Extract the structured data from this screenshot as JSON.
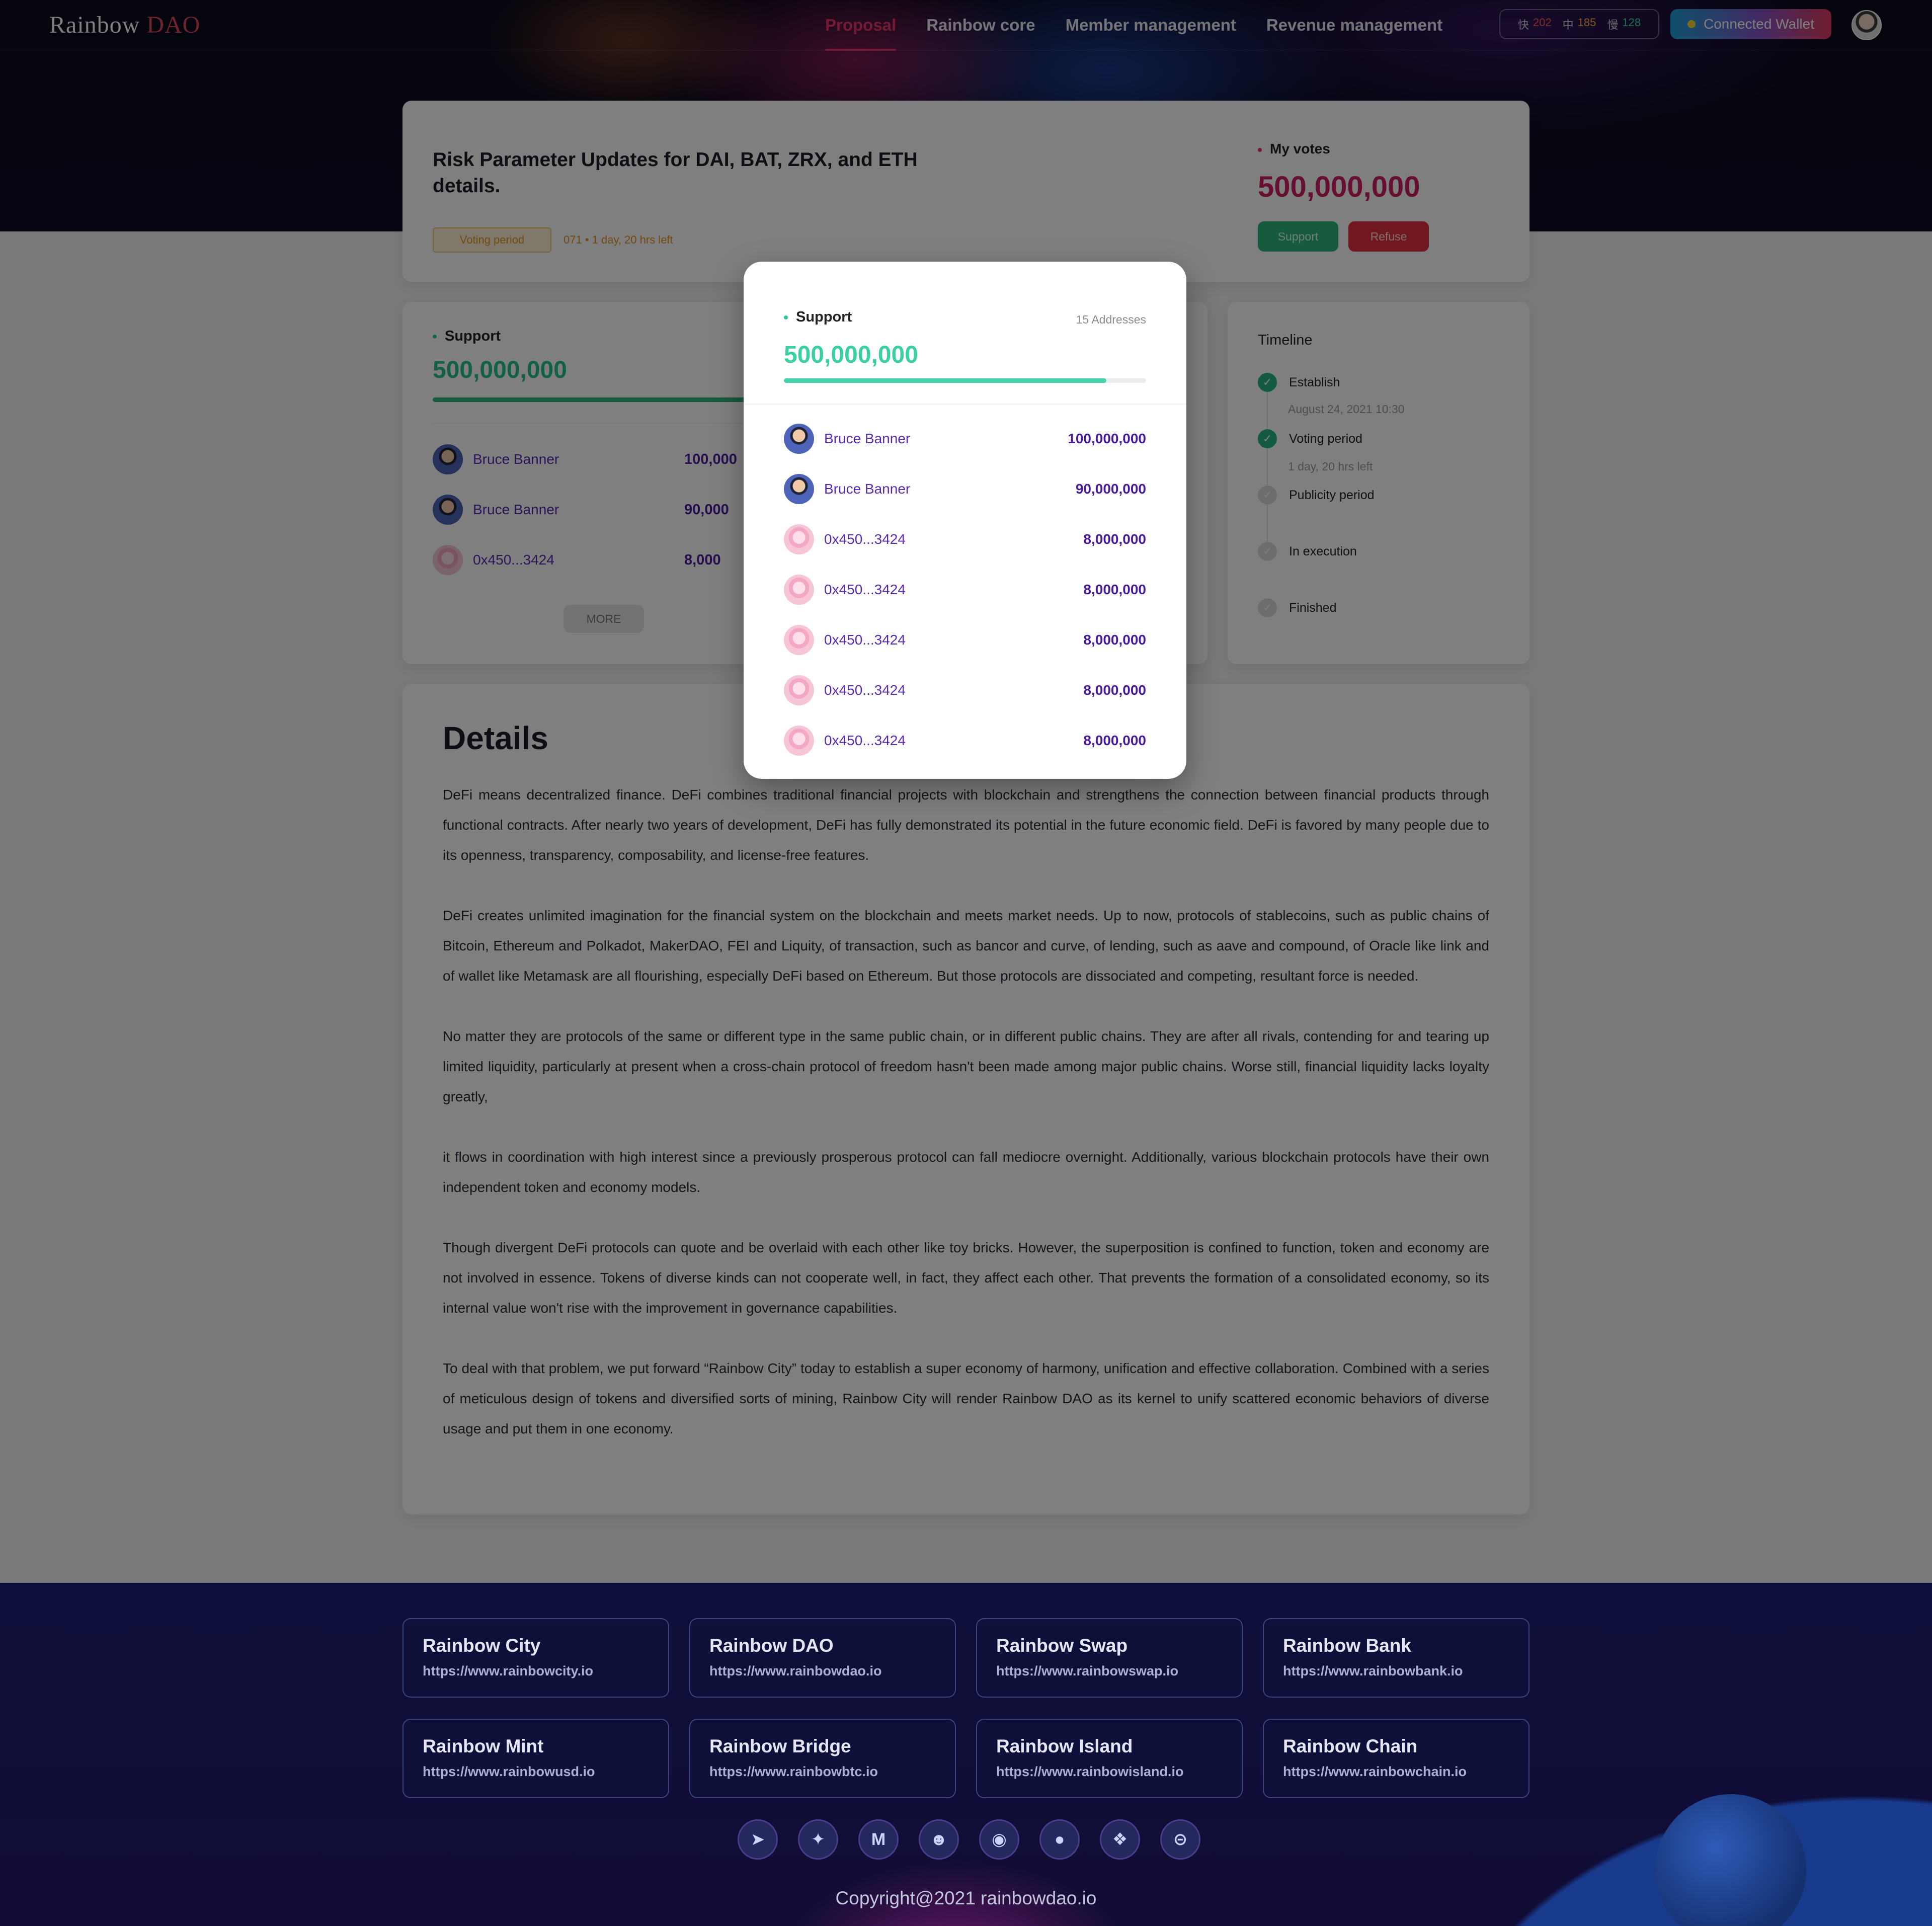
{
  "nav": {
    "logo_text": "Rainbow",
    "logo_accent": "DAO",
    "links": [
      "Proposal",
      "Rainbow core",
      "Member management",
      "Revenue management"
    ],
    "active_link": "Proposal",
    "stats": [
      {
        "key": "快",
        "value": "202",
        "color": "#ff5a5a"
      },
      {
        "key": "中",
        "value": "185",
        "color": "#ffb341"
      },
      {
        "key": "慢",
        "value": "128",
        "color": "#3ee0a4"
      }
    ],
    "wallet_label": "Connected Wallet"
  },
  "proposal": {
    "title": "Risk Parameter Updates for DAI, BAT, ZRX, and ETH details.",
    "status_badge": "Voting period",
    "time_left": "071 • 1 day, 20 hrs left",
    "my_votes_label": "My votes",
    "my_votes_value": "500,000,000",
    "support_button": "Support",
    "refuse_button": "Refuse"
  },
  "support_panel": {
    "label": "Support",
    "value": "500,000,000",
    "progress_fraction": 0.9,
    "rows": [
      {
        "name": "Bruce Banner",
        "amount": "100,000",
        "avatar": "person"
      },
      {
        "name": "Bruce Banner",
        "amount": "90,000",
        "avatar": "person"
      },
      {
        "name": "0x450...3424",
        "amount": "8,000",
        "avatar": "pig"
      }
    ],
    "more_button": "MORE"
  },
  "timeline": {
    "title": "Timeline",
    "steps": [
      {
        "name": "Establish",
        "sub": "August 24, 2021  10:30",
        "done": true
      },
      {
        "name": "Voting period",
        "sub": "1 day, 20 hrs left",
        "done": true
      },
      {
        "name": "Publicity period",
        "sub": "",
        "done": false
      },
      {
        "name": "In execution",
        "sub": "",
        "done": false
      },
      {
        "name": "Finished",
        "sub": "",
        "done": false
      }
    ]
  },
  "details": {
    "title": "Details",
    "paragraphs": [
      "DeFi means decentralized finance. DeFi combines traditional financial projects with blockchain and strengthens the connection between financial products through functional contracts. After nearly two years of development, DeFi has fully demonstrated its potential in the future economic field. DeFi is favored by many people due to its openness, transparency, composability, and license-free features.",
      "DeFi creates unlimited imagination for the financial system on the blockchain and meets market needs. Up to now, protocols of stablecoins, such as public chains of Bitcoin, Ethereum and Polkadot, MakerDAO, FEI and Liquity, of transaction, such as bancor and curve, of lending, such as aave and compound, of Oracle like link and of wallet like Metamask are all flourishing, especially DeFi based on Ethereum. But those protocols are dissociated and competing, resultant force is needed.",
      "No matter they are protocols of the same or different type in the same public chain, or in different public chains. They are after all rivals, contending for and tearing up limited liquidity, particularly at present when a cross-chain protocol of freedom hasn't been made among major public chains. Worse still, financial liquidity lacks loyalty greatly,",
      "it flows in coordination with high interest since a previously prosperous protocol can fall mediocre overnight. Additionally, various blockchain protocols have their own independent token and economy models.",
      "Though divergent DeFi protocols can quote and be overlaid with each other like toy bricks. However, the superposition is confined to function, token and economy are not involved in essence. Tokens of diverse kinds can not cooperate well, in fact, they affect each other. That prevents the formation of a consolidated economy, so its internal value won't rise with the improvement in governance capabilities.",
      "To deal with that problem, we put forward “Rainbow City” today to establish a super economy of harmony, unification and effective collaboration. Combined with a series of meticulous design of tokens and diversified sorts of mining, Rainbow City will render Rainbow DAO as its kernel to unify scattered economic behaviors of diverse usage and put them in one economy."
    ]
  },
  "modal": {
    "label": "Support",
    "address_count": "15 Addresses",
    "value": "500,000,000",
    "progress_fraction": 0.89,
    "rows": [
      {
        "name": "Bruce Banner",
        "amount": "100,000,000",
        "avatar": "person"
      },
      {
        "name": "Bruce Banner",
        "amount": "90,000,000",
        "avatar": "person"
      },
      {
        "name": "0x450...3424",
        "amount": "8,000,000",
        "avatar": "pig"
      },
      {
        "name": "0x450...3424",
        "amount": "8,000,000",
        "avatar": "pig"
      },
      {
        "name": "0x450...3424",
        "amount": "8,000,000",
        "avatar": "pig"
      },
      {
        "name": "0x450...3424",
        "amount": "8,000,000",
        "avatar": "pig"
      },
      {
        "name": "0x450...3424",
        "amount": "8,000,000",
        "avatar": "pig"
      }
    ]
  },
  "footer": {
    "sites": [
      {
        "name": "Rainbow City",
        "url": "https://www.rainbowcity.io"
      },
      {
        "name": "Rainbow DAO",
        "url": "https://www.rainbowdao.io"
      },
      {
        "name": "Rainbow Swap",
        "url": "https://www.rainbowswap.io"
      },
      {
        "name": "Rainbow Bank",
        "url": "https://www.rainbowbank.io"
      },
      {
        "name": "Rainbow Mint",
        "url": "https://www.rainbowusd.io"
      },
      {
        "name": "Rainbow Bridge",
        "url": "https://www.rainbowbtc.io"
      },
      {
        "name": "Rainbow Island",
        "url": "https://www.rainbowisland.io"
      },
      {
        "name": "Rainbow Chain",
        "url": "https://www.rainbowchain.io"
      }
    ],
    "socials": [
      {
        "icon": "telegram-icon",
        "glyph": "➤"
      },
      {
        "icon": "twitter-icon",
        "glyph": "✦"
      },
      {
        "icon": "medium-icon",
        "glyph": "M"
      },
      {
        "icon": "reddit-icon",
        "glyph": "☻"
      },
      {
        "icon": "discord-icon",
        "glyph": "◉"
      },
      {
        "icon": "github-icon",
        "glyph": "●"
      },
      {
        "icon": "gitbook-icon",
        "glyph": "❖"
      },
      {
        "icon": "coinmarketcap-icon",
        "glyph": "⊝"
      }
    ],
    "copyright": "Copyright@2021 rainbowdao.io"
  }
}
